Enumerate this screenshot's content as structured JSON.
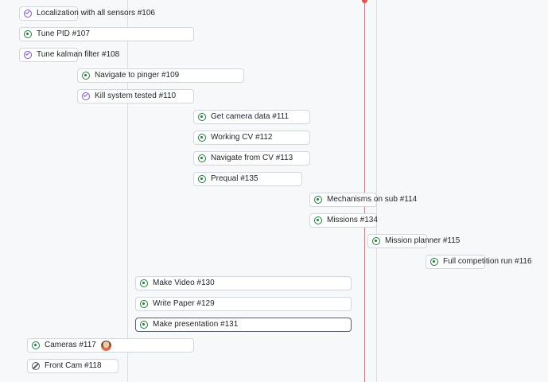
{
  "items": [
    {
      "id": "i106",
      "label": "Localization with all sensors #106",
      "status": "closed"
    },
    {
      "id": "i107",
      "label": "Tune PID #107",
      "status": "open"
    },
    {
      "id": "i108",
      "label": "Tune kalman filter #108",
      "status": "closed"
    },
    {
      "id": "i109",
      "label": "Navigate to pinger #109",
      "status": "open"
    },
    {
      "id": "i110",
      "label": "Kill system tested #110",
      "status": "closed"
    },
    {
      "id": "i111",
      "label": "Get camera data #111",
      "status": "open"
    },
    {
      "id": "i112",
      "label": "Working CV #112",
      "status": "open"
    },
    {
      "id": "i113",
      "label": "Navigate from CV #113",
      "status": "open"
    },
    {
      "id": "i135",
      "label": "Prequal #135",
      "status": "open"
    },
    {
      "id": "i114",
      "label": "Mechanisms on sub #114",
      "status": "open"
    },
    {
      "id": "i134",
      "label": "Missions #134",
      "status": "open"
    },
    {
      "id": "i115",
      "label": "Mission planner #115",
      "status": "open"
    },
    {
      "id": "i116",
      "label": "Full competition run #116",
      "status": "open"
    },
    {
      "id": "i130",
      "label": "Make Video #130",
      "status": "open"
    },
    {
      "id": "i129",
      "label": "Write Paper #129",
      "status": "open"
    },
    {
      "id": "i131",
      "label": "Make presentation #131",
      "status": "open"
    },
    {
      "id": "i117",
      "label": "Cameras #117",
      "status": "open",
      "has_avatar": true
    },
    {
      "id": "i118",
      "label": "Front Cam #118",
      "status": "skipped"
    }
  ]
}
